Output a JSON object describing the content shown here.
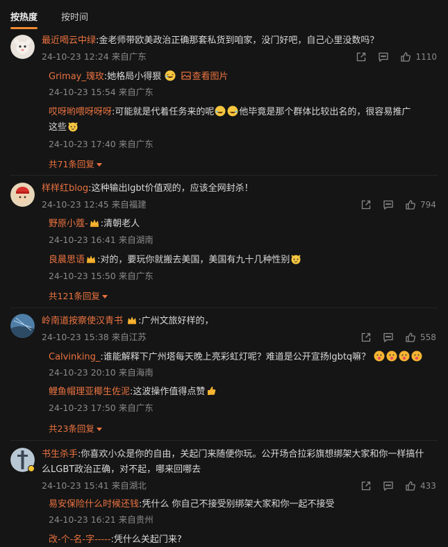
{
  "tabs": {
    "hot": "按热度",
    "time": "按时间"
  },
  "comments": [
    {
      "user": "最近喝云中绿",
      "text": ":金老师带欧美政治正确那套私货到咱家，没门好吧，自己心里没数吗？",
      "meta": "24-10-23 12:24 来自广东",
      "likes": "1110",
      "replies": [
        {
          "user": "Grimay_瑰玫",
          "text": ":她格局小得狠",
          "link": "查看图片",
          "meta": "24-10-23 15:54 来自广东"
        },
        {
          "user": "哎呀哟喂呀呀呀",
          "text": ":可能就是代着任务来的呢",
          "text2": "他毕竟是那个群体比较出名的，很容易推广",
          "text3": "这些",
          "meta": "24-10-23 17:40 来自广东"
        }
      ],
      "more": "共71条回复"
    },
    {
      "user": "样样红blog",
      "text": ":这种输出lgbt价值观的，应该全网封杀！",
      "meta": "24-10-23 12:45 来自福建",
      "likes": "794",
      "replies": [
        {
          "user": "野原小蔻-",
          "text": ":清朝老人",
          "meta": "24-10-23 16:41 来自湖南"
        },
        {
          "user": "良晨思语",
          "text": ":对的，要玩你就搬去美国，美国有九十几种性别",
          "meta": "24-10-23 15:50 来自广东"
        }
      ],
      "more": "共121条回复"
    },
    {
      "user": "岭南道按察使汉青书",
      "text": ":广州文旅好样的，",
      "meta": "24-10-23 15:38 来自江苏",
      "likes": "558",
      "replies": [
        {
          "user": "Calvinking_",
          "text": ":谁能解释下广州塔每天晚上亮彩虹灯呢？难道是公开宣扬lgbtq嘛？",
          "meta": "24-10-23 20:10 来自海南"
        },
        {
          "user": "鲤鱼帽理亚椰生佐泥",
          "text": ":这波操作值得点赞",
          "meta": "24-10-23 17:50 来自广东"
        }
      ],
      "more": "共23条回复"
    },
    {
      "user": "书生杀手",
      "text": ":你喜欢小众是你的自由，关起门来随便你玩。公开场合拉彩旗想绑架大家和你一样搞什",
      "text2": "么LGBT政治正确，对不起，哪来回哪去",
      "meta": "24-10-23 15:41 来自湖北",
      "likes": "433",
      "replies": [
        {
          "user": "易安保险什么时候还钱",
          "text": ":凭什么 你自己不接受别绑架大家和你一起不接受",
          "meta": "24-10-23 16:21 来自贵州"
        },
        {
          "user": "改-个-名-字-----",
          "text": ":凭什么关起门来?"
        }
      ]
    }
  ]
}
